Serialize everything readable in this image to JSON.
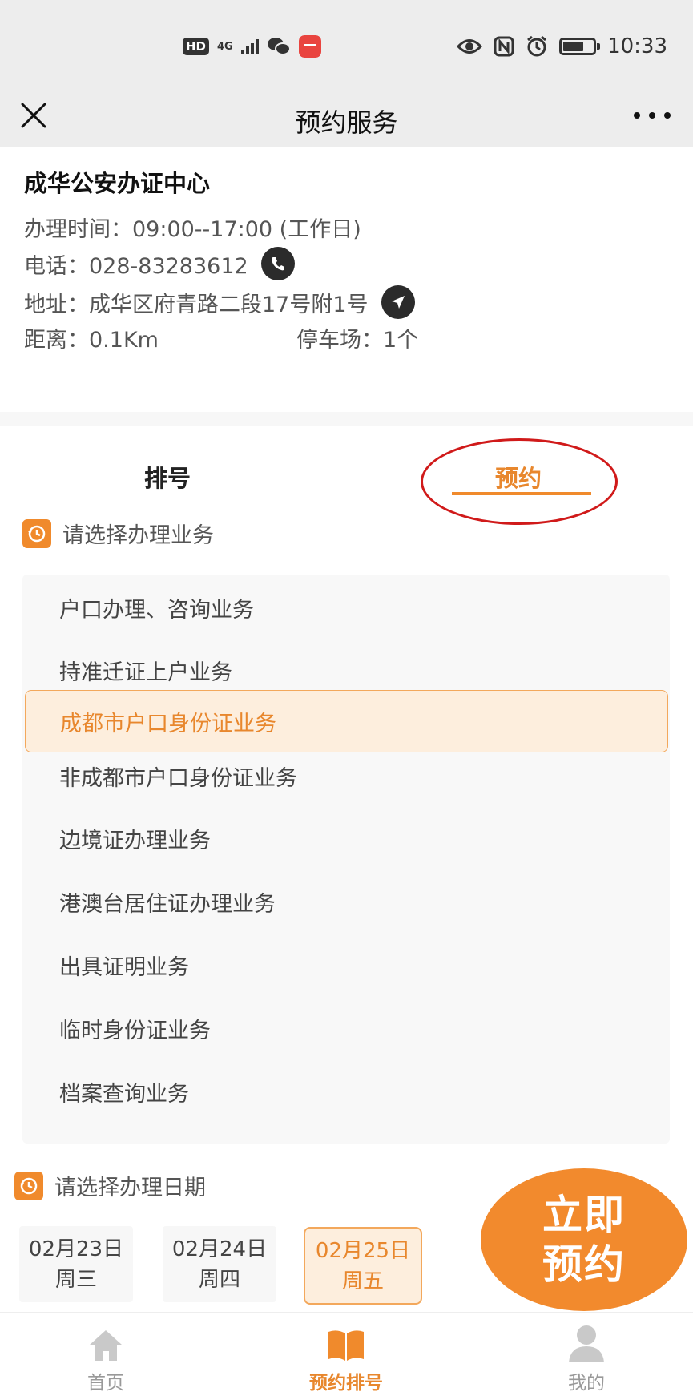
{
  "status_bar": {
    "hd": "HD",
    "network": "4G",
    "time": "10:33"
  },
  "nav": {
    "title": "预约服务"
  },
  "info": {
    "center_name": "成华公安办证中心",
    "hours": "办理时间：09:00--17:00 (工作日)",
    "phone": "电话：028-83283612",
    "address": "地址：成华区府青路二段17号附1号",
    "distance": "距离：0.1Km",
    "parking": "停车场：1个"
  },
  "tabs": {
    "queue": "排号",
    "appointment": "预约",
    "active": "appointment"
  },
  "service_section": {
    "header": "请选择办理业务",
    "items": [
      "户口办理、咨询业务",
      "持准迁证上户业务",
      "成都市户口身份证业务",
      "非成都市户口身份证业务",
      "边境证办理业务",
      "港澳台居住证办理业务",
      "出具证明业务",
      "临时身份证业务",
      "档案查询业务"
    ],
    "selected_index": 2
  },
  "date_section": {
    "header": "请选择办理日期",
    "dates": [
      {
        "date": "02月23日",
        "weekday": "周三"
      },
      {
        "date": "02月24日",
        "weekday": "周四"
      },
      {
        "date": "02月25日",
        "weekday": "周五"
      }
    ],
    "selected_index": 2
  },
  "book_button": {
    "line1": "立即",
    "line2": "预约"
  },
  "bottom_nav": {
    "home": "首页",
    "booking": "预约排号",
    "mine": "我的"
  },
  "colors": {
    "accent": "#f08a2c",
    "selected_bg": "#fdeedd",
    "annotation": "#d01a1a"
  }
}
